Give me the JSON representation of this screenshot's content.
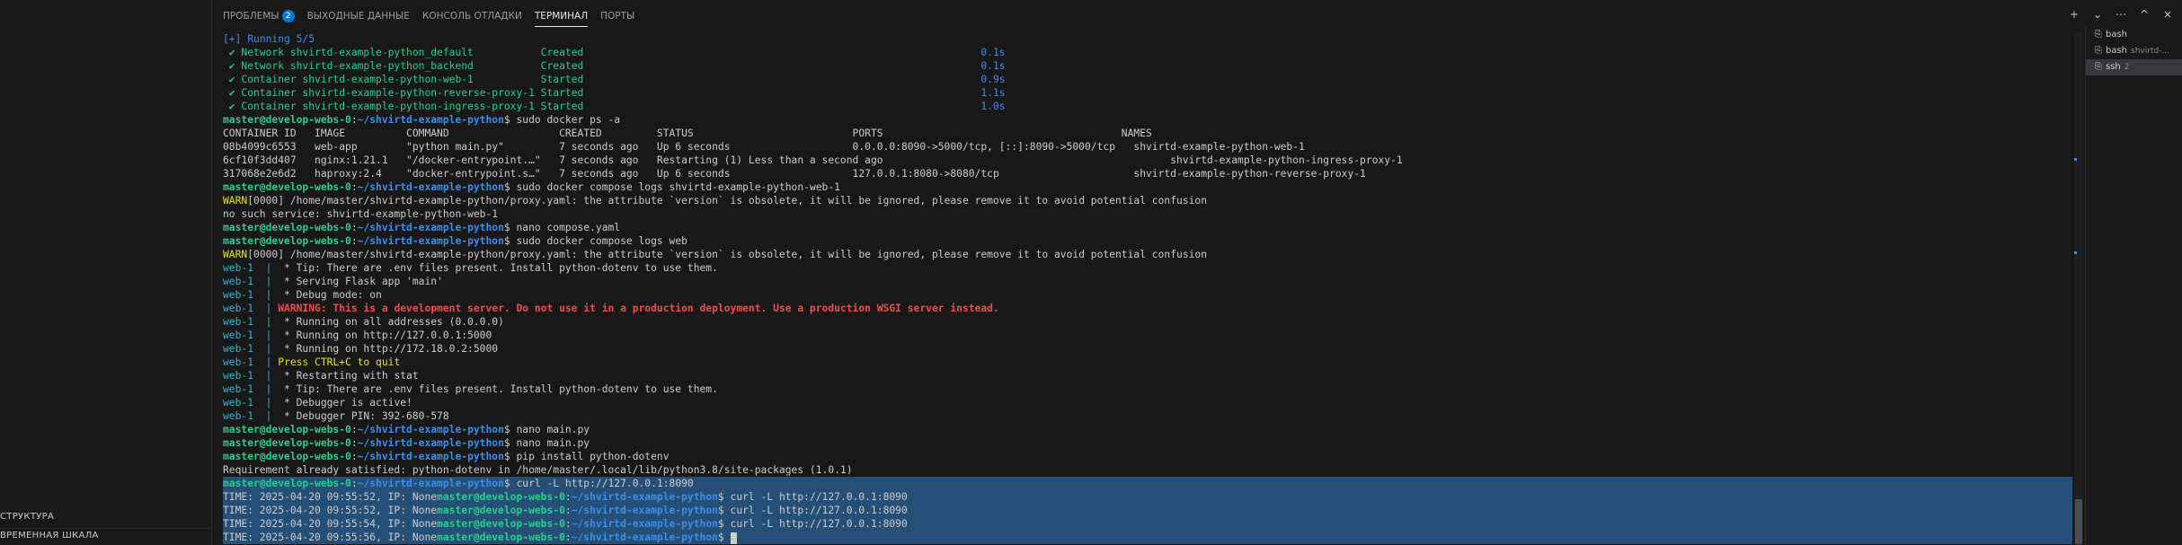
{
  "sidebar": {
    "structure": "СТРУКТУРА",
    "timeline": "ВРЕМЕННАЯ ШКАЛА"
  },
  "tabs": [
    {
      "label": "ПРОБЛЕМЫ",
      "badge": "2"
    },
    {
      "label": "ВЫХОДНЫЕ ДАННЫЕ"
    },
    {
      "label": "КОНСОЛЬ ОТЛАДКИ"
    },
    {
      "label": "ТЕРМИНАЛ"
    },
    {
      "label": "ПОРТЫ"
    }
  ],
  "actions": {
    "new": "+",
    "split": "⌄",
    "more": "⋯",
    "maximize": "^",
    "close": "×"
  },
  "terminals": [
    {
      "name": "bash",
      "sub": ""
    },
    {
      "name": "bash",
      "sub": "shvirtd-..."
    },
    {
      "name": "ssh",
      "sub": "2"
    }
  ],
  "colors": {
    "prompt": "#23d18b",
    "path": "#3b8eea",
    "selection": "#264f78",
    "warning": "#e5e510",
    "error": "#f14c4c"
  },
  "prompt": {
    "user": "master@develop-webs-0",
    "path": "~/shvirtd-example-python"
  },
  "compose_up": {
    "header": "[+] Running 5/5",
    "rows": [
      {
        "name": " ✔ Network shvirtd-example-python_default           ",
        "state": "Created",
        "pad": "                                                                 ",
        "time": "0.1s"
      },
      {
        "name": " ✔ Network shvirtd-example-python_backend           ",
        "state": "Created",
        "pad": "                                                                 ",
        "time": "0.1s"
      },
      {
        "name": " ✔ Container shvirtd-example-python-web-1           ",
        "state": "Started",
        "pad": "                                                                 ",
        "time": "0.9s"
      },
      {
        "name": " ✔ Container shvirtd-example-python-reverse-proxy-1 ",
        "state": "Started",
        "pad": "                                                                 ",
        "time": "1.1s"
      },
      {
        "name": " ✔ Container shvirtd-example-python-ingress-proxy-1 ",
        "state": "Started",
        "pad": "                                                                 ",
        "time": "1.0s"
      }
    ]
  },
  "cmd1": "sudo docker ps -a",
  "ps": {
    "header": "CONTAINER ID   IMAGE          COMMAND                  CREATED         STATUS                          PORTS                                       NAMES",
    "rows": [
      "08b4099c6553   web-app        \"python main.py\"         7 seconds ago   Up 6 seconds                    0.0.0.0:8090->5000/tcp, [::]:8090->5000/tcp   shvirtd-example-python-web-1",
      "6cf10f3dd407   nginx:1.21.1   \"/docker-entrypoint.…\"   7 seconds ago   Restarting (1) Less than a second ago                                               shvirtd-example-python-ingress-proxy-1",
      "317068e2e6d2   haproxy:2.4    \"docker-entrypoint.s…\"   7 seconds ago   Up 6 seconds                    127.0.0.1:8080->8080/tcp                      shvirtd-example-python-reverse-proxy-1"
    ]
  },
  "cmd2": "sudo docker compose logs shvirtd-example-python-web-1",
  "warn1": {
    "tag": "WARN",
    "rest": "[0000] /home/master/shvirtd-example-python/proxy.yaml: the attribute `version` is obsolete, it will be ignored, please remove it to avoid potential confusion"
  },
  "no_such": "no such service: shvirtd-example-python-web-1",
  "cmd3": "nano compose.yaml",
  "cmd4": "sudo docker compose logs web",
  "warn2": {
    "tag": "WARN",
    "rest": "[0000] /home/master/shvirtd-example-python/proxy.yaml: the attribute `version` is obsolete, it will be ignored, please remove it to avoid potential confusion"
  },
  "logs": {
    "prefix": "web-1  | ",
    "lines": [
      {
        "text": " * Tip: There are .env files present. Install python-dotenv to use them.",
        "kind": "normal"
      },
      {
        "text": " * Serving Flask app 'main'",
        "kind": "normal"
      },
      {
        "text": " * Debug mode: on",
        "kind": "normal"
      },
      {
        "text": "WARNING: This is a development server. Do not use it in a production deployment. Use a production WSGI server instead.",
        "kind": "error"
      },
      {
        "text": " * Running on all addresses (0.0.0.0)",
        "kind": "normal"
      },
      {
        "text": " * Running on http://127.0.0.1:5000",
        "kind": "normal"
      },
      {
        "text": " * Running on http://172.18.0.2:5000",
        "kind": "normal"
      },
      {
        "text": "Press CTRL+C to quit",
        "kind": "warn"
      },
      {
        "text": " * Restarting with stat",
        "kind": "normal"
      },
      {
        "text": " * Tip: There are .env files present. Install python-dotenv to use them.",
        "kind": "normal"
      },
      {
        "text": " * Debugger is active!",
        "kind": "normal"
      },
      {
        "text": " * Debugger PIN: 392-680-578",
        "kind": "normal"
      }
    ]
  },
  "cmd5": "nano main.py",
  "cmd6": "nano main.py",
  "cmd7": "pip install python-dotenv",
  "pip_out": "Requirement already satisfied: python-dotenv in /home/master/.local/lib/python3.8/site-packages (1.0.1)",
  "curl": {
    "first_cmd": "curl -L http://127.0.0.1:8090",
    "rows": [
      {
        "time": "TIME: 2025-04-20 09:55:52, IP: None",
        "cmd": "curl -L http://127.0.0.1:8090"
      },
      {
        "time": "TIME: 2025-04-20 09:55:52, IP: None",
        "cmd": "curl -L http://127.0.0.1:8090"
      },
      {
        "time": "TIME: 2025-04-20 09:55:54, IP: None",
        "cmd": "curl -L http://127.0.0.1:8090"
      },
      {
        "time": "TIME: 2025-04-20 09:55:56, IP: None",
        "cmd": ""
      }
    ]
  }
}
